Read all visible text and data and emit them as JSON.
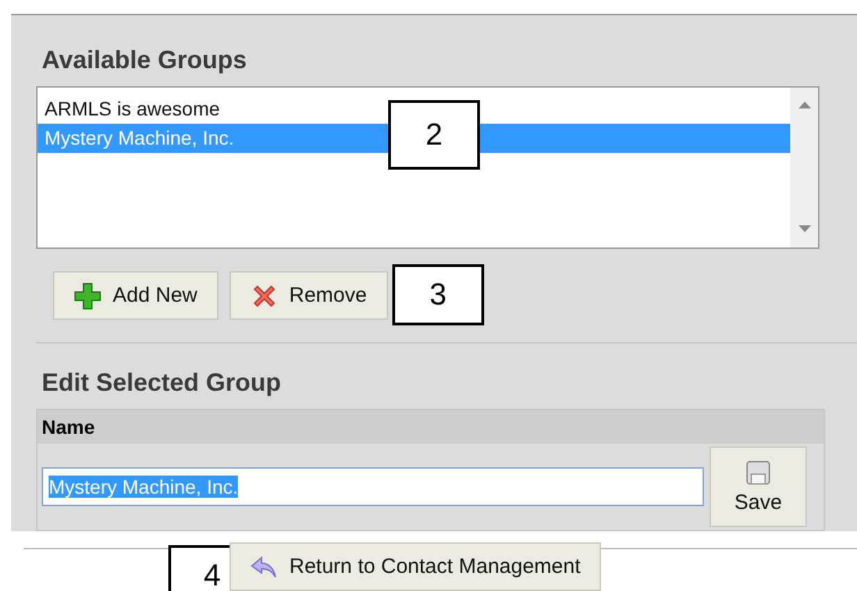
{
  "available_groups": {
    "title": "Available Groups",
    "items": [
      {
        "label": "ARMLS is awesome",
        "selected": false
      },
      {
        "label": "Mystery Machine, Inc.",
        "selected": true
      }
    ]
  },
  "list_buttons": [
    {
      "kind": "add",
      "label": "Add New"
    },
    {
      "kind": "remove",
      "label": "Remove"
    }
  ],
  "edit_group": {
    "title": "Edit Selected Group",
    "column": "Name",
    "value": "Mystery Machine, Inc.",
    "save_label": "Save"
  },
  "return_button": {
    "label": "Return to Contact Management"
  },
  "callouts": [
    {
      "kind": "list",
      "label": "2"
    },
    {
      "kind": "remove",
      "label": "3"
    },
    {
      "kind": "return",
      "label": "4"
    }
  ]
}
